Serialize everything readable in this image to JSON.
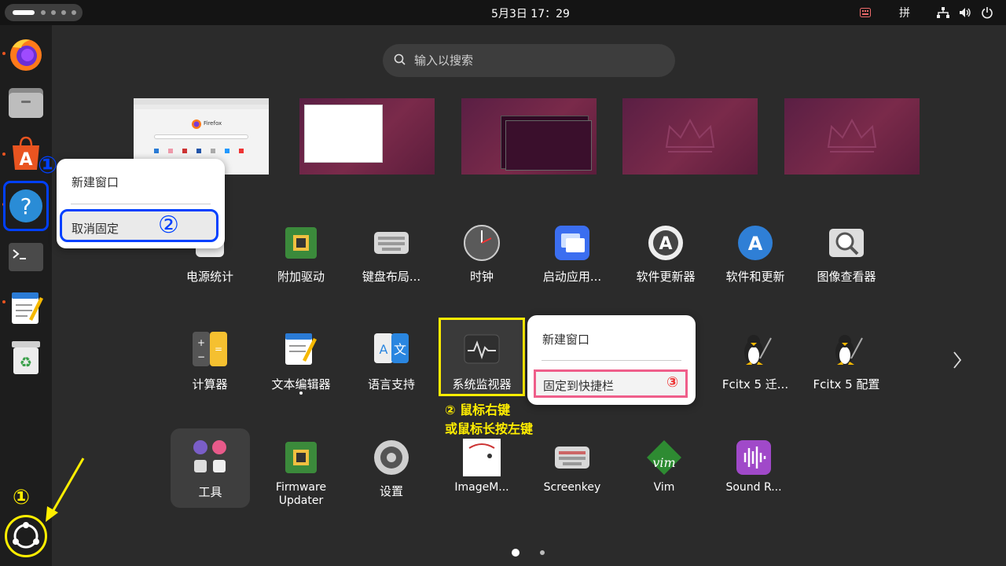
{
  "topbar": {
    "clock": "5月3日  17：29",
    "input_method": "拼"
  },
  "search": {
    "placeholder": "输入以搜索"
  },
  "workspace_firefox_label": "Firefox",
  "dock_menu": {
    "new_window": "新建窗口",
    "unpin": "取消固定",
    "marker_step1": "①",
    "marker_step2": "②"
  },
  "app_menu": {
    "new_window": "新建窗口",
    "pin": "固定到快捷栏",
    "marker_step3": "③"
  },
  "annotations": {
    "step1_bottom": "①",
    "right_click_line1": "② 鼠标右键",
    "right_click_line2": "或鼠标长按左键"
  },
  "apps_row1": [
    "电源统计",
    "附加驱动",
    "键盘布局...",
    "时钟",
    "启动应用...",
    "软件更新器",
    "软件和更新",
    "图像查看器"
  ],
  "apps_row2": [
    "计算器",
    "文本编辑器",
    "语言支持",
    "系统监视器",
    "",
    "",
    "Fcitx 5 迁...",
    "Fcitx 5 配置"
  ],
  "apps_row3": [
    "工具",
    "Firmware\nUpdater",
    "设置",
    "ImageM...",
    "Screenkey",
    "Vim",
    "Sound R..."
  ],
  "colors": {
    "accent": "#e95420",
    "dock_highlight": "#0040ff",
    "monitor_highlight": "#ffee00",
    "pin_highlight": "#ef5e8a"
  }
}
